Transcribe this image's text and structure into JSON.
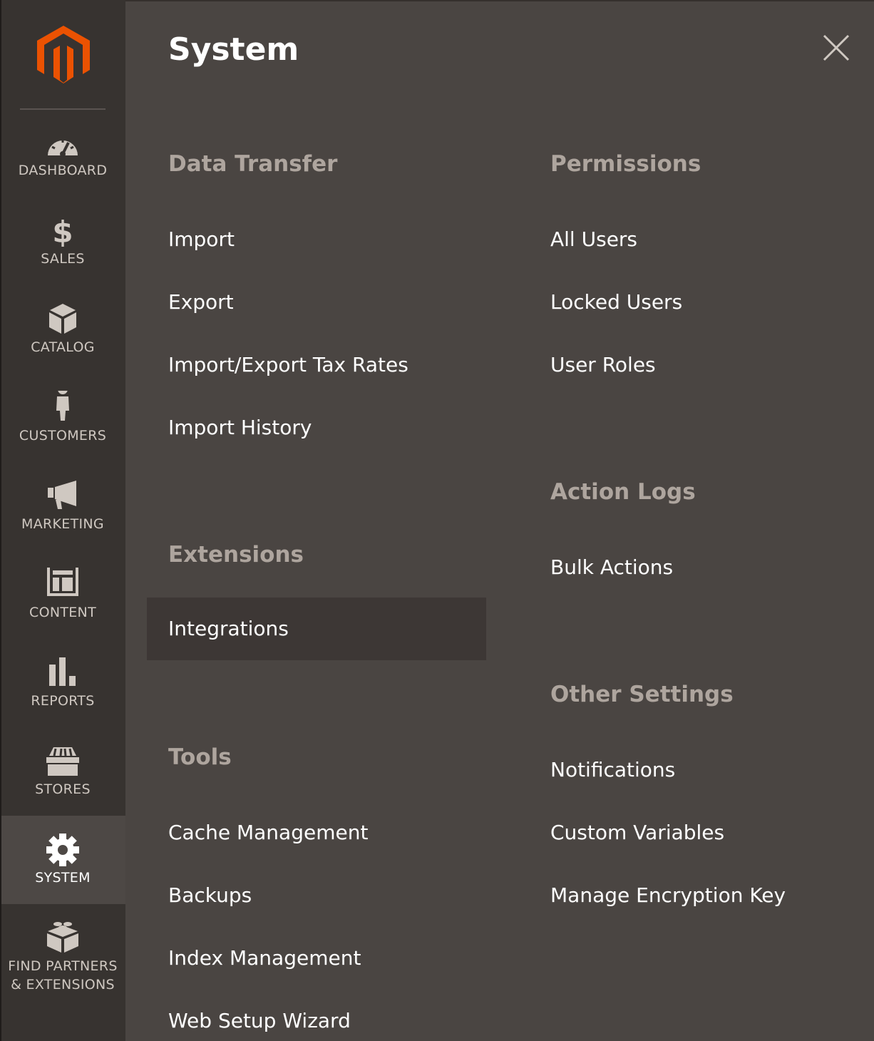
{
  "brand": {
    "accent": "#eb5202",
    "logo_icon": "magento-logo-icon"
  },
  "sidebar": {
    "items": [
      {
        "label": "DASHBOARD",
        "icon": "dashboard-gauge-icon"
      },
      {
        "label": "SALES",
        "icon": "dollar-icon"
      },
      {
        "label": "CATALOG",
        "icon": "box-icon"
      },
      {
        "label": "CUSTOMERS",
        "icon": "person-icon"
      },
      {
        "label": "MARKETING",
        "icon": "megaphone-icon"
      },
      {
        "label": "CONTENT",
        "icon": "layout-icon"
      },
      {
        "label": "REPORTS",
        "icon": "bar-chart-icon"
      },
      {
        "label": "STORES",
        "icon": "storefront-icon"
      },
      {
        "label": "SYSTEM",
        "icon": "gear-icon",
        "active": true
      },
      {
        "label_line1": "FIND PARTNERS",
        "label_line2": "& EXTENSIONS",
        "icon": "lego-brick-icon"
      }
    ]
  },
  "panel": {
    "title": "System",
    "close_icon": "close-icon",
    "sections": {
      "data_transfer": {
        "heading": "Data Transfer",
        "links": [
          "Import",
          "Export",
          "Import/Export Tax Rates",
          "Import History"
        ]
      },
      "extensions": {
        "heading": "Extensions",
        "links": [
          "Integrations"
        ]
      },
      "tools": {
        "heading": "Tools",
        "links": [
          "Cache Management",
          "Backups",
          "Index Management",
          "Web Setup Wizard"
        ]
      },
      "permissions": {
        "heading": "Permissions",
        "links": [
          "All Users",
          "Locked Users",
          "User Roles"
        ]
      },
      "action_logs": {
        "heading": "Action Logs",
        "links": [
          "Bulk Actions"
        ]
      },
      "other_settings": {
        "heading": "Other Settings",
        "links": [
          "Notifications",
          "Custom Variables",
          "Manage Encryption Key"
        ]
      }
    }
  }
}
